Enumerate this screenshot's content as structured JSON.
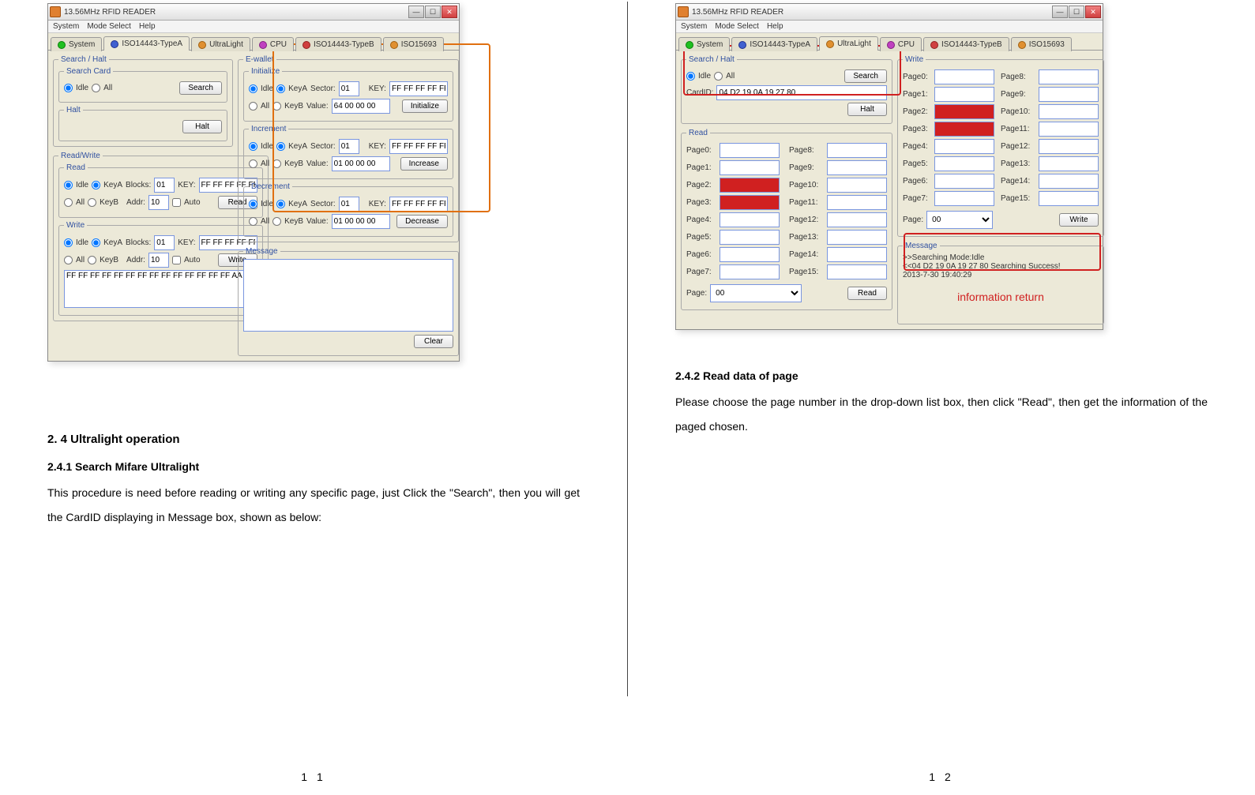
{
  "left": {
    "app": {
      "title": "13.56MHz RFID READER",
      "menu": [
        "System",
        "Mode Select",
        "Help"
      ],
      "tabs": [
        "System",
        "ISO14443-TypeA",
        "UltraLight",
        "CPU",
        "ISO14443-TypeB",
        "ISO15693"
      ],
      "search_halt_title": "Search / Halt",
      "search_card_title": "Search Card",
      "idle_label": "Idle",
      "all_label": "All",
      "search_btn": "Search",
      "halt_title": "Halt",
      "halt_btn": "Halt",
      "rw_title": "Read/Write",
      "read_title": "Read",
      "write_title": "Write",
      "keya_label": "KeyA",
      "keyb_label": "KeyB",
      "blocks_label": "Blocks:",
      "blocks_val": "01",
      "key_label": "KEY:",
      "key_val": "FF FF FF FF FF FF",
      "addr_label": "Addr:",
      "addr_val": "10",
      "auto_label": "Auto",
      "read_btn": "Read",
      "write_btn": "Write",
      "textarea_val": "FF FF FF FF FF FF FF FF FF FF FF FF FF FF AA BB",
      "ewallet_title": "E-wallet",
      "initialize_title": "Initialize",
      "increment_title": "Increment",
      "decrement_title": "Decrement",
      "sector_label": "Sector:",
      "sector_val": "01",
      "value_label": "Value:",
      "init_value": "64 00 00 00",
      "inc_value": "01 00 00 00",
      "dec_value": "01 00 00 00",
      "initialize_btn": "Initialize",
      "increase_btn": "Increase",
      "decrease_btn": "Decrease",
      "message_title": "Message",
      "clear_btn": "Clear"
    },
    "h3": "2. 4   Ultralight operation",
    "h4": "2.4.1   Search Mifare Ultralight",
    "p1": "This procedure is need before reading or writing any specific page, just Click the \"Search\", then you will get the CardID displaying in Message box, shown as below:",
    "pagenum": "1 1"
  },
  "right": {
    "app": {
      "title": "13.56MHz RFID READER",
      "menu": [
        "System",
        "Mode Select",
        "Help"
      ],
      "tabs": [
        "System",
        "ISO14443-TypeA",
        "UltraLight",
        "CPU",
        "ISO14443-TypeB",
        "ISO15693"
      ],
      "search_halt_title": "Search / Halt",
      "idle_label": "Idle",
      "all_label": "All",
      "search_btn": "Search",
      "cardid_label": "CardID:",
      "cardid_val": "04 D2 19 0A 19 27 80",
      "halt_btn": "Halt",
      "read_title": "Read",
      "page_label": "Page:",
      "page_sel": "00",
      "read_btn": "Read",
      "write_title": "Write",
      "write_btn": "Write",
      "wpage_sel": "00",
      "message_title": "Message",
      "msg_l1": ">>Searching     Mode:Idle",
      "msg_l2": "<<04 D2 19 0A 19 27 80      Searching Success!",
      "msg_l3": "2013-7-30  19:40:29",
      "annot": "information return",
      "pages_left": [
        "Page0:",
        "Page1:",
        "Page2:",
        "Page3:",
        "Page4:",
        "Page5:",
        "Page6:",
        "Page7:"
      ],
      "pages_right": [
        "Page8:",
        "Page9:",
        "Page10:",
        "Page11:",
        "Page12:",
        "Page13:",
        "Page14:",
        "Page15:"
      ]
    },
    "h4": "2.4.2   Read data of page",
    "p1": "Please choose the page number in the drop-down list box, then click \"Read\", then get the information of the paged chosen.",
    "pagenum": "1 2"
  }
}
